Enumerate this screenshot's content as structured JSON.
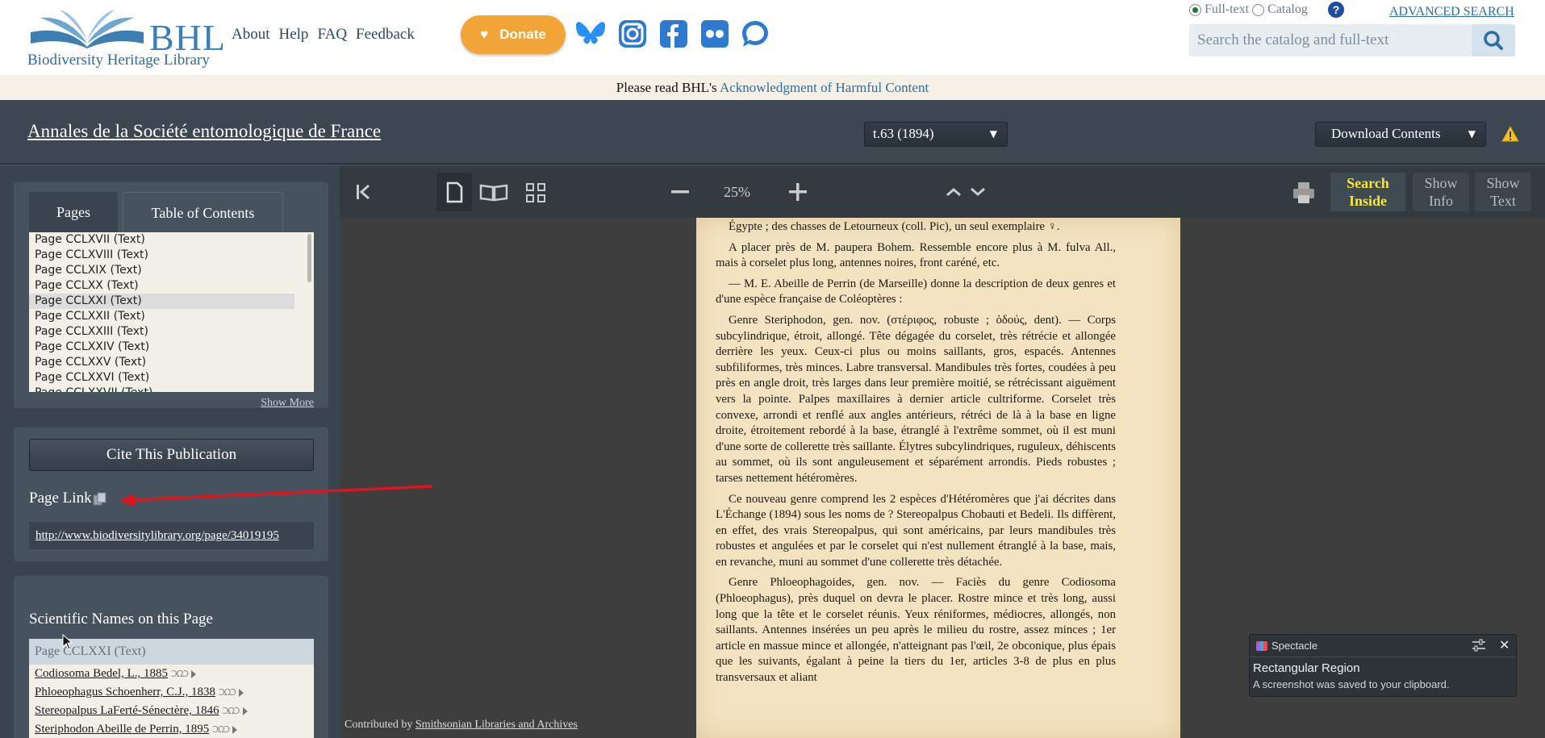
{
  "header": {
    "logo_text": "BHL",
    "logo_subtitle": "Biodiversity Heritage Library",
    "nav": [
      "About",
      "Help",
      "FAQ",
      "Feedback"
    ],
    "donate_label": "Donate",
    "social_icons": [
      "bluesky-icon",
      "instagram-icon",
      "facebook-icon",
      "flickr-icon",
      "chat-icon"
    ],
    "search_mode_fulltext": "Full-text",
    "search_mode_catalog": "Catalog",
    "search_mode_selected": "Full-text",
    "help_symbol": "?",
    "advanced_search": "ADVANCED SEARCH",
    "search_placeholder": "Search the catalog and full-text",
    "brand_color": "#3d7fb3",
    "donate_color": "#f3a437"
  },
  "notice": {
    "prefix": "Please read BHL's ",
    "link": "Acknowledgment of Harmful Content"
  },
  "titlebar": {
    "title": "Annales de la Société entomologique de France",
    "volume": "t.63 (1894)",
    "volume_caret": "▼",
    "download": "Download Contents",
    "download_caret": "▼"
  },
  "sidebar": {
    "tabs": [
      "Pages",
      "Table of Contents"
    ],
    "active_tab": "Pages",
    "pages": [
      "Page CCLXVII (Text)",
      "Page CCLXVIII (Text)",
      "Page CCLXIX (Text)",
      "Page CCLXX (Text)",
      "Page CCLXXI (Text)",
      "Page CCLXXII (Text)",
      "Page CCLXXIII (Text)",
      "Page CCLXXIV (Text)",
      "Page CCLXXV (Text)",
      "Page CCLXXVI (Text)",
      "Page CCLXXVII (Text)"
    ],
    "selected_page": "Page CCLXXI (Text)",
    "show_more": "Show More",
    "cite_label": "Cite This Publication",
    "page_link_label": "Page Link",
    "page_link_url": "http://www.biodiversitylibrary.org/page/34019195",
    "names_title": "Scientific Names on this Page",
    "names_header": "Page CCLXXI (Text)",
    "names": [
      "Codiosoma Bedel, L., 1885",
      "Phloeophagus Schoenherr, C.J., 1838",
      "Stereopalpus LaFerté-Sénectère, 1846",
      "Steriphodon Abeille de Perrin, 1895"
    ]
  },
  "viewer": {
    "zoom": "25%",
    "search_inside": [
      "Search",
      "Inside"
    ],
    "show_info": [
      "Show",
      "Info"
    ],
    "show_text": [
      "Show",
      "Text"
    ],
    "search_inside_color": "#f5e73b",
    "contributed_prefix": "Contributed by ",
    "contributor": "Smithsonian Libraries and Archives",
    "page_paragraphs": [
      "Égypte ; des chasses de Letourneux (coll. Pic), un seul exemplaire ♀.",
      "A placer près de M. paupera Bohem. Ressemble encore plus à M. fulva All., mais à corselet plus long, antennes noires, front caréné, etc.",
      "— M. E. Abeille de Perrin (de Marseille) donne la description de deux genres et d'une espèce française de Coléoptères :",
      "Genre Steriphodon, gen. nov. (στέριφος, robuste ; ὀδούς, dent). — Corps subcylindrique, étroit, allongé. Tête dégagée du corselet, très rétrécie et allongée derrière les yeux. Ceux-ci plus ou moins saillants, gros, espacés. Antennes subfiliformes, très minces. Labre transversal. Mandibules très fortes, coudées à peu près en angle droit, très larges dans leur première moitié, se rétrécissant aiguëment vers la pointe. Palpes maxillaires à dernier article cultriforme. Corselet très convexe, arrondi et renflé aux angles antérieurs, rétréci de là à la base en ligne droite, étroitement rebordé à la base, étranglé à l'extrême sommet, où il est muni d'une sorte de collerette très saillante. Élytres subcylindriques, ruguleux, déhiscents au sommet, où ils sont anguleusement et séparément arrondis. Pieds robustes ; tarses nettement hétéromères.",
      "Ce nouveau genre comprend les 2 espèces d'Hétéromères que j'ai décrites dans L'Échange (1894) sous les noms de ? Stereopalpus Chobauti et Bedeli. Ils diffèrent, en effet, des vrais Stereopalpus, qui sont américains, par leurs mandibules très robustes et angulées et par le corselet qui n'est nullement étranglé à la base, mais, en revanche, muni au sommet d'une collerette très détachée.",
      "Genre Phloeophagoides, gen. nov. — Faciès du genre Codiosoma (Phloeophagus), près duquel on devra le placer. Rostre mince et très long, aussi long que la tête et le corselet réunis. Yeux réniformes, médiocres, allongés, non saillants. Antennes insérées un peu après le milieu du rostre, assez minces ; 1er article en massue mince et allongée, n'atteignant pas l'œil, 2e obconique, plus épais que les suivants, égalant à peine la tiers du 1er, articles 3-8 de plus en plus transversaux et aliant"
    ]
  },
  "notification": {
    "app": "Spectacle",
    "title": "Rectangular Region",
    "body": "A screenshot was saved to your clipboard."
  },
  "annotation": {
    "arrow_color": "#e0141e"
  }
}
